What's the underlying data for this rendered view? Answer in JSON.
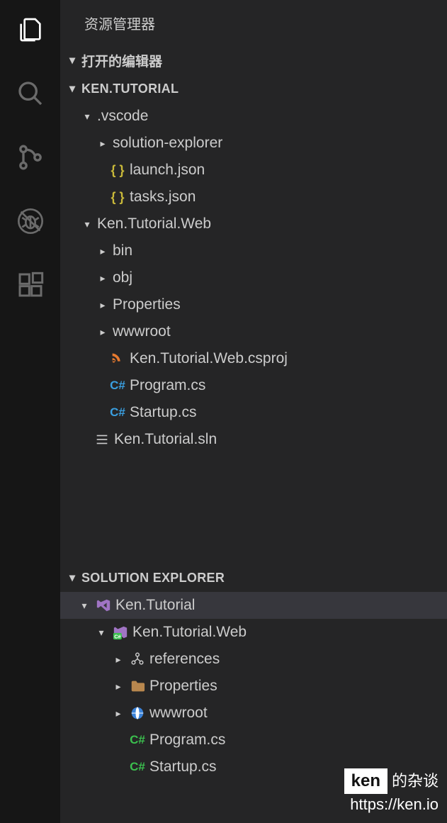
{
  "sidebar": {
    "title": "资源管理器",
    "openEditors": "打开的编辑器",
    "project": "KEN.TUTORIAL",
    "solutionExplorer": "SOLUTION EXPLORER"
  },
  "fileTree": {
    "vscode": ".vscode",
    "solutionExplorerFolder": "solution-explorer",
    "launchJson": "launch.json",
    "tasksJson": "tasks.json",
    "kenTutorialWeb": "Ken.Tutorial.Web",
    "bin": "bin",
    "obj": "obj",
    "properties": "Properties",
    "wwwroot": "wwwroot",
    "csproj": "Ken.Tutorial.Web.csproj",
    "programCs": "Program.cs",
    "startupCs": "Startup.cs",
    "sln": "Ken.Tutorial.sln"
  },
  "solutionTree": {
    "solution": "Ken.Tutorial",
    "project": "Ken.Tutorial.Web",
    "references": "references",
    "properties": "Properties",
    "wwwroot": "wwwroot",
    "programCs": "Program.cs",
    "startupCs": "Startup.cs"
  },
  "watermark": {
    "brand": "ken",
    "suffix": "的杂谈",
    "url": "https://ken.io"
  },
  "colors": {
    "jsonBrace": "#c9b93a",
    "csharpBlue": "#3a9fe0",
    "csharpGreen": "#3bbf4e",
    "xmlOrange": "#e77a2f",
    "vsPurple": "#a074c4",
    "folderBrown": "#b8874e",
    "globeBlue": "#3a82d8"
  }
}
